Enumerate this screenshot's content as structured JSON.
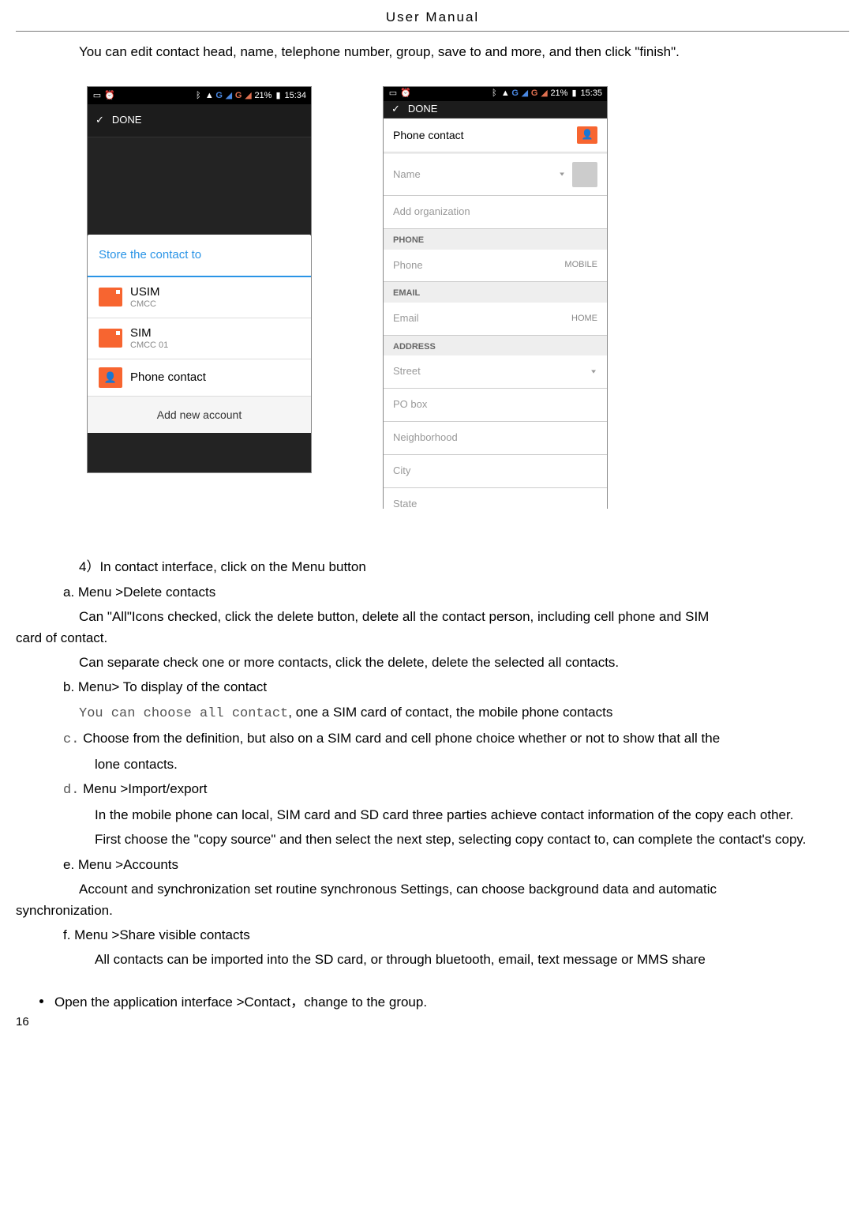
{
  "header": {
    "title": "User    Manual"
  },
  "intro": "You can edit contact head, name, telephone number, group, save to and more, and then click \"finish\".",
  "phone1": {
    "status": {
      "percent": "21%",
      "time": "15:34"
    },
    "done": "DONE",
    "dialog_title": "Store the contact to",
    "items": [
      {
        "main": "USIM",
        "sub": "CMCC"
      },
      {
        "main": "SIM",
        "sub": "CMCC 01"
      },
      {
        "main": "Phone contact",
        "sub": ""
      }
    ],
    "footer": "Add new account"
  },
  "phone2": {
    "status": {
      "percent": "21%",
      "time": "15:35"
    },
    "done": "DONE",
    "phone_contact": "Phone contact",
    "name_ph": "Name",
    "addorg_ph": "Add organization",
    "sec_phone": "PHONE",
    "phone_ph": "Phone",
    "phone_type": "MOBILE",
    "sec_email": "EMAIL",
    "email_ph": "Email",
    "email_type": "HOME",
    "sec_address": "ADDRESS",
    "addr_fields": [
      "Street",
      "PO box",
      "Neighborhood",
      "City",
      "State"
    ]
  },
  "content": {
    "line4": "4）In contact   interface, click on the Menu button",
    "a_h": "a.    Menu >Delete contacts",
    "a_p1_pre": "Can \"All\"Icons checked, click the delete button, delete all the contact person, including cell phone and SIM",
    "a_p1_tail": "card of contact.",
    "a_p2": "Can separate check one or more contacts, click the delete, delete the selected all contacts.",
    "b_h": "b.    Menu> To display of the contact",
    "b_mono": "You can choose all contact",
    "b_rest": ", one a SIM card of contact, the mobile phone contacts",
    "c_h_letter": "c.",
    "c_h_rest": "    Choose from the definition, but also on a SIM card and cell phone choice whether or not to show that all the",
    "c_tail": "lone contacts.",
    "d_h_letter": "d.",
    "d_h_rest": "    Menu >Import/export",
    "d_p1": "In the mobile phone can local, SIM card and SD card three parties achieve contact information of the copy each other.",
    "d_p2": "First choose the \"copy source\" and then select the next step, selecting copy contact to, can complete the contact's copy.",
    "e_h": "e.    Menu >Accounts",
    "e_p_pre": "Account and synchronization set routine synchronous Settings, can choose background data and automatic",
    "e_p_tail": "synchronization.",
    "f_h": "f.    Menu >Share visible contacts",
    "f_p": "All contacts can be imported into the SD card, or through bluetooth, email, text message or MMS share",
    "bullet": "Open the   application interface    >Contact，change to the group."
  },
  "page_number": "16"
}
